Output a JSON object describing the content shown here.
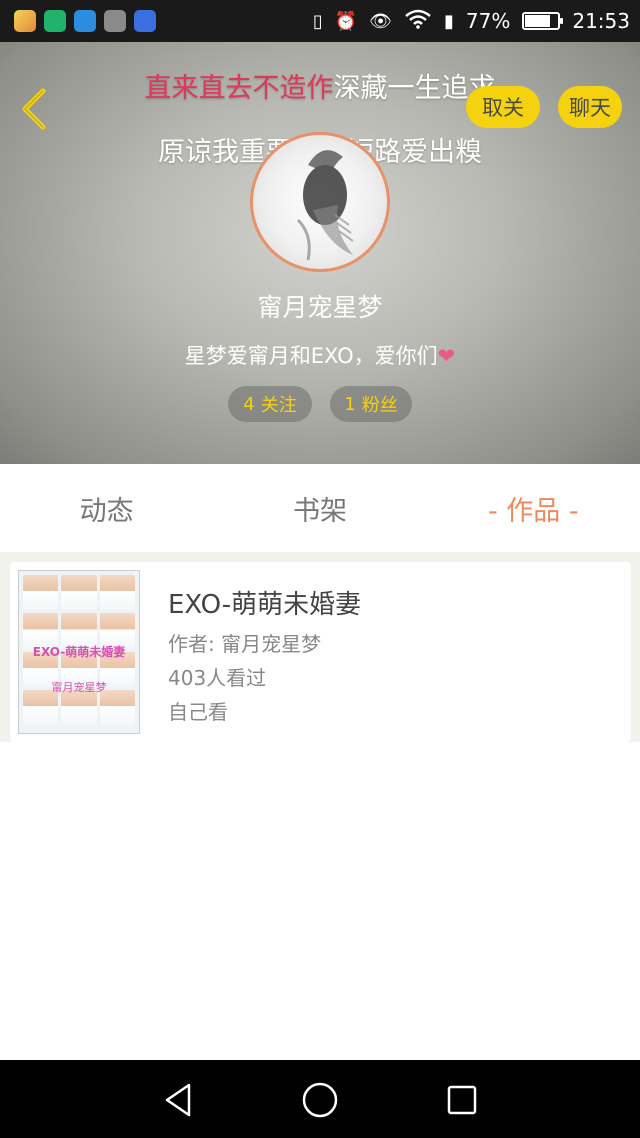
{
  "status_bar": {
    "app_icons": [
      "app-icon-1",
      "shield-app-icon",
      "heart-monitor-app-icon",
      "gallery-app-icon",
      "paw-app-icon"
    ],
    "battery_percent": "77%",
    "battery_level": 0.77,
    "time": "21:53"
  },
  "header": {
    "lyric_highlight": "直来直去不造作",
    "lyric_rest": "深藏一生追求",
    "lyric_line2": "原谅我重要时候短路爱出糗",
    "unfollow_label": "取关",
    "chat_label": "聊天",
    "username": "甯月宠星梦",
    "bio": "星梦爱甯月和EXO，爱你们",
    "following_count": "4",
    "following_label": "关注",
    "fans_count": "1",
    "fans_label": "粉丝"
  },
  "tabs": [
    {
      "label": "动态"
    },
    {
      "label": "书架"
    },
    {
      "label": "- 作品 -"
    }
  ],
  "works": [
    {
      "title": "EXO-萌萌未婚妻",
      "author": "作者: 甯月宠星梦",
      "views": "403人看过",
      "visibility": "自己看",
      "cover_title": "EXO-萌萌未婚妻",
      "cover_author": "甯月宠星梦"
    }
  ],
  "colors": {
    "accent_yellow": "#f5d20e",
    "active_tab": "#ee8a5a",
    "lyric_highlight": "#e0385a"
  }
}
